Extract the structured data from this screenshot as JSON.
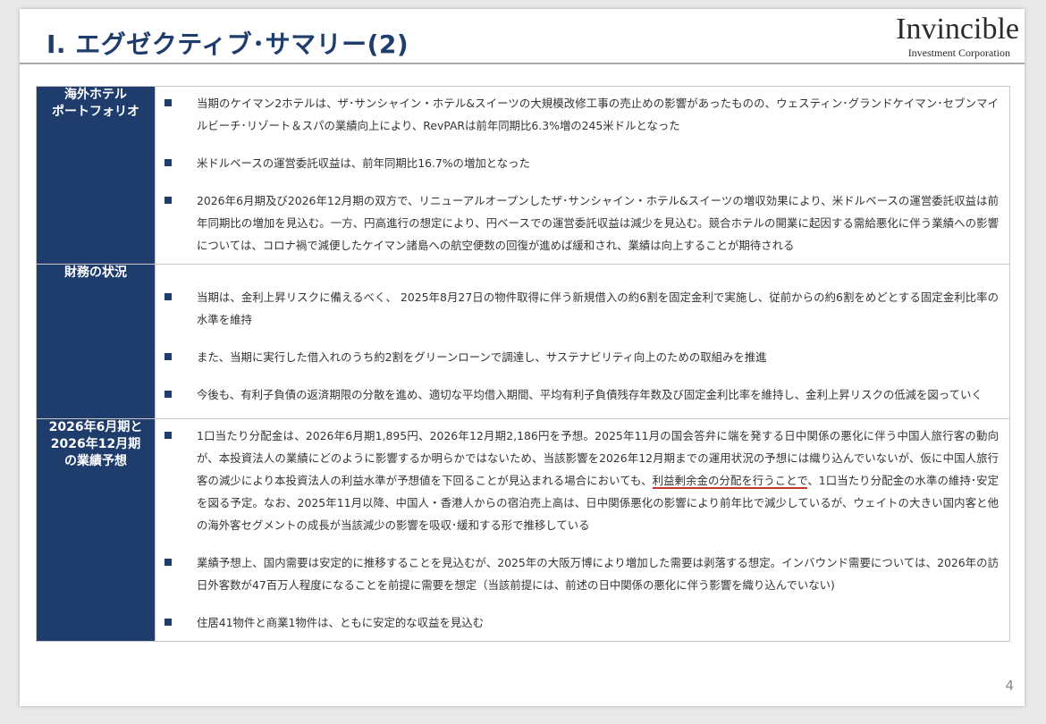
{
  "page": {
    "title": "Ⅰ. エグゼクティブ･サマリー(2)",
    "logo_name": "Invincible",
    "logo_sub": "Investment Corporation",
    "page_number": "4"
  },
  "sections": [
    {
      "label": "海外ホテル\nポートフォリオ",
      "items": [
        "当期のケイマン2ホテルは、ザ･サンシャイン・ホテル&スイーツの大規模改修工事の売止めの影響があったものの、ウェスティン･グランドケイマン･セブンマイルビーチ･リゾート＆スパの業績向上により、RevPARは前年同期比6.3%増の245米ドルとなった",
        "米ドルベースの運営委託収益は、前年同期比16.7%の増加となった",
        "2026年6月期及び2026年12月期の双方で、リニューアルオープンしたザ･サンシャイン・ホテル&スイーツの増収効果により、米ドルベースの運営委託収益は前年同期比の増加を見込む。一方、円高進行の想定により、円ベースでの運営委託収益は減少を見込む。競合ホテルの開業に起因する需給悪化に伴う業績への影響については、コロナ禍で減便したケイマン諸島への航空便数の回復が進めば緩和され、業績は向上することが期待される"
      ]
    },
    {
      "label": "財務の状況",
      "items": [
        "当期は、金利上昇リスクに備えるべく、 2025年8月27日の物件取得に伴う新規借入の約6割を固定金利で実施し、従前からの約6割をめどとする固定金利比率の水準を維持",
        "また、当期に実行した借入れのうち約2割をグリーンローンで調達し、サステナビリティ向上のための取組みを推進",
        "今後も、有利子負債の返済期限の分散を進め、適切な平均借入期間、平均有利子負債残存年数及び固定金利比率を維持し、金利上昇リスクの低減を図っていく"
      ]
    },
    {
      "label": "2026年6月期と\n2026年12月期\nの業績予想",
      "item1_part1": "1口当たり分配金は、2026年6月期1,895円、2026年12月期2,186円を予想。2025年11月の国会答弁に端を発する日中関係の悪化に伴う中国人旅行客の動向が、本投資法人の業績にどのように影響するか明らかではないため、当該影響を2026年12月期までの運用状況の予想には織り込んでいないが、仮に中国人旅行客の減少により本投資法人の利益水準が予想値を下回ることが見込まれる場合においても、",
      "item1_underlined": "利益剰余金の分配を行うことで",
      "item1_part2": "、1口当たり分配金の水準の維持･安定を図る予定。なお、2025年11月以降、中国人・香港人からの宿泊売上高は、日中関係悪化の影響により前年比で減少しているが、ウェイトの大きい国内客と他の海外客セグメントの成長が当該減少の影響を吸収･緩和する形で推移している",
      "items": [
        "業績予想上、国内需要は安定的に推移することを見込むが、2025年の大阪万博により増加した需要は剥落する想定。インバウンド需要については、2026年の訪日外客数が47百万人程度になることを前提に需要を想定（当該前提には、前述の日中関係の悪化に伴う影響を織り込んでいない)",
        "住居41物件と商業1物件は、ともに安定的な収益を見込む"
      ]
    }
  ]
}
